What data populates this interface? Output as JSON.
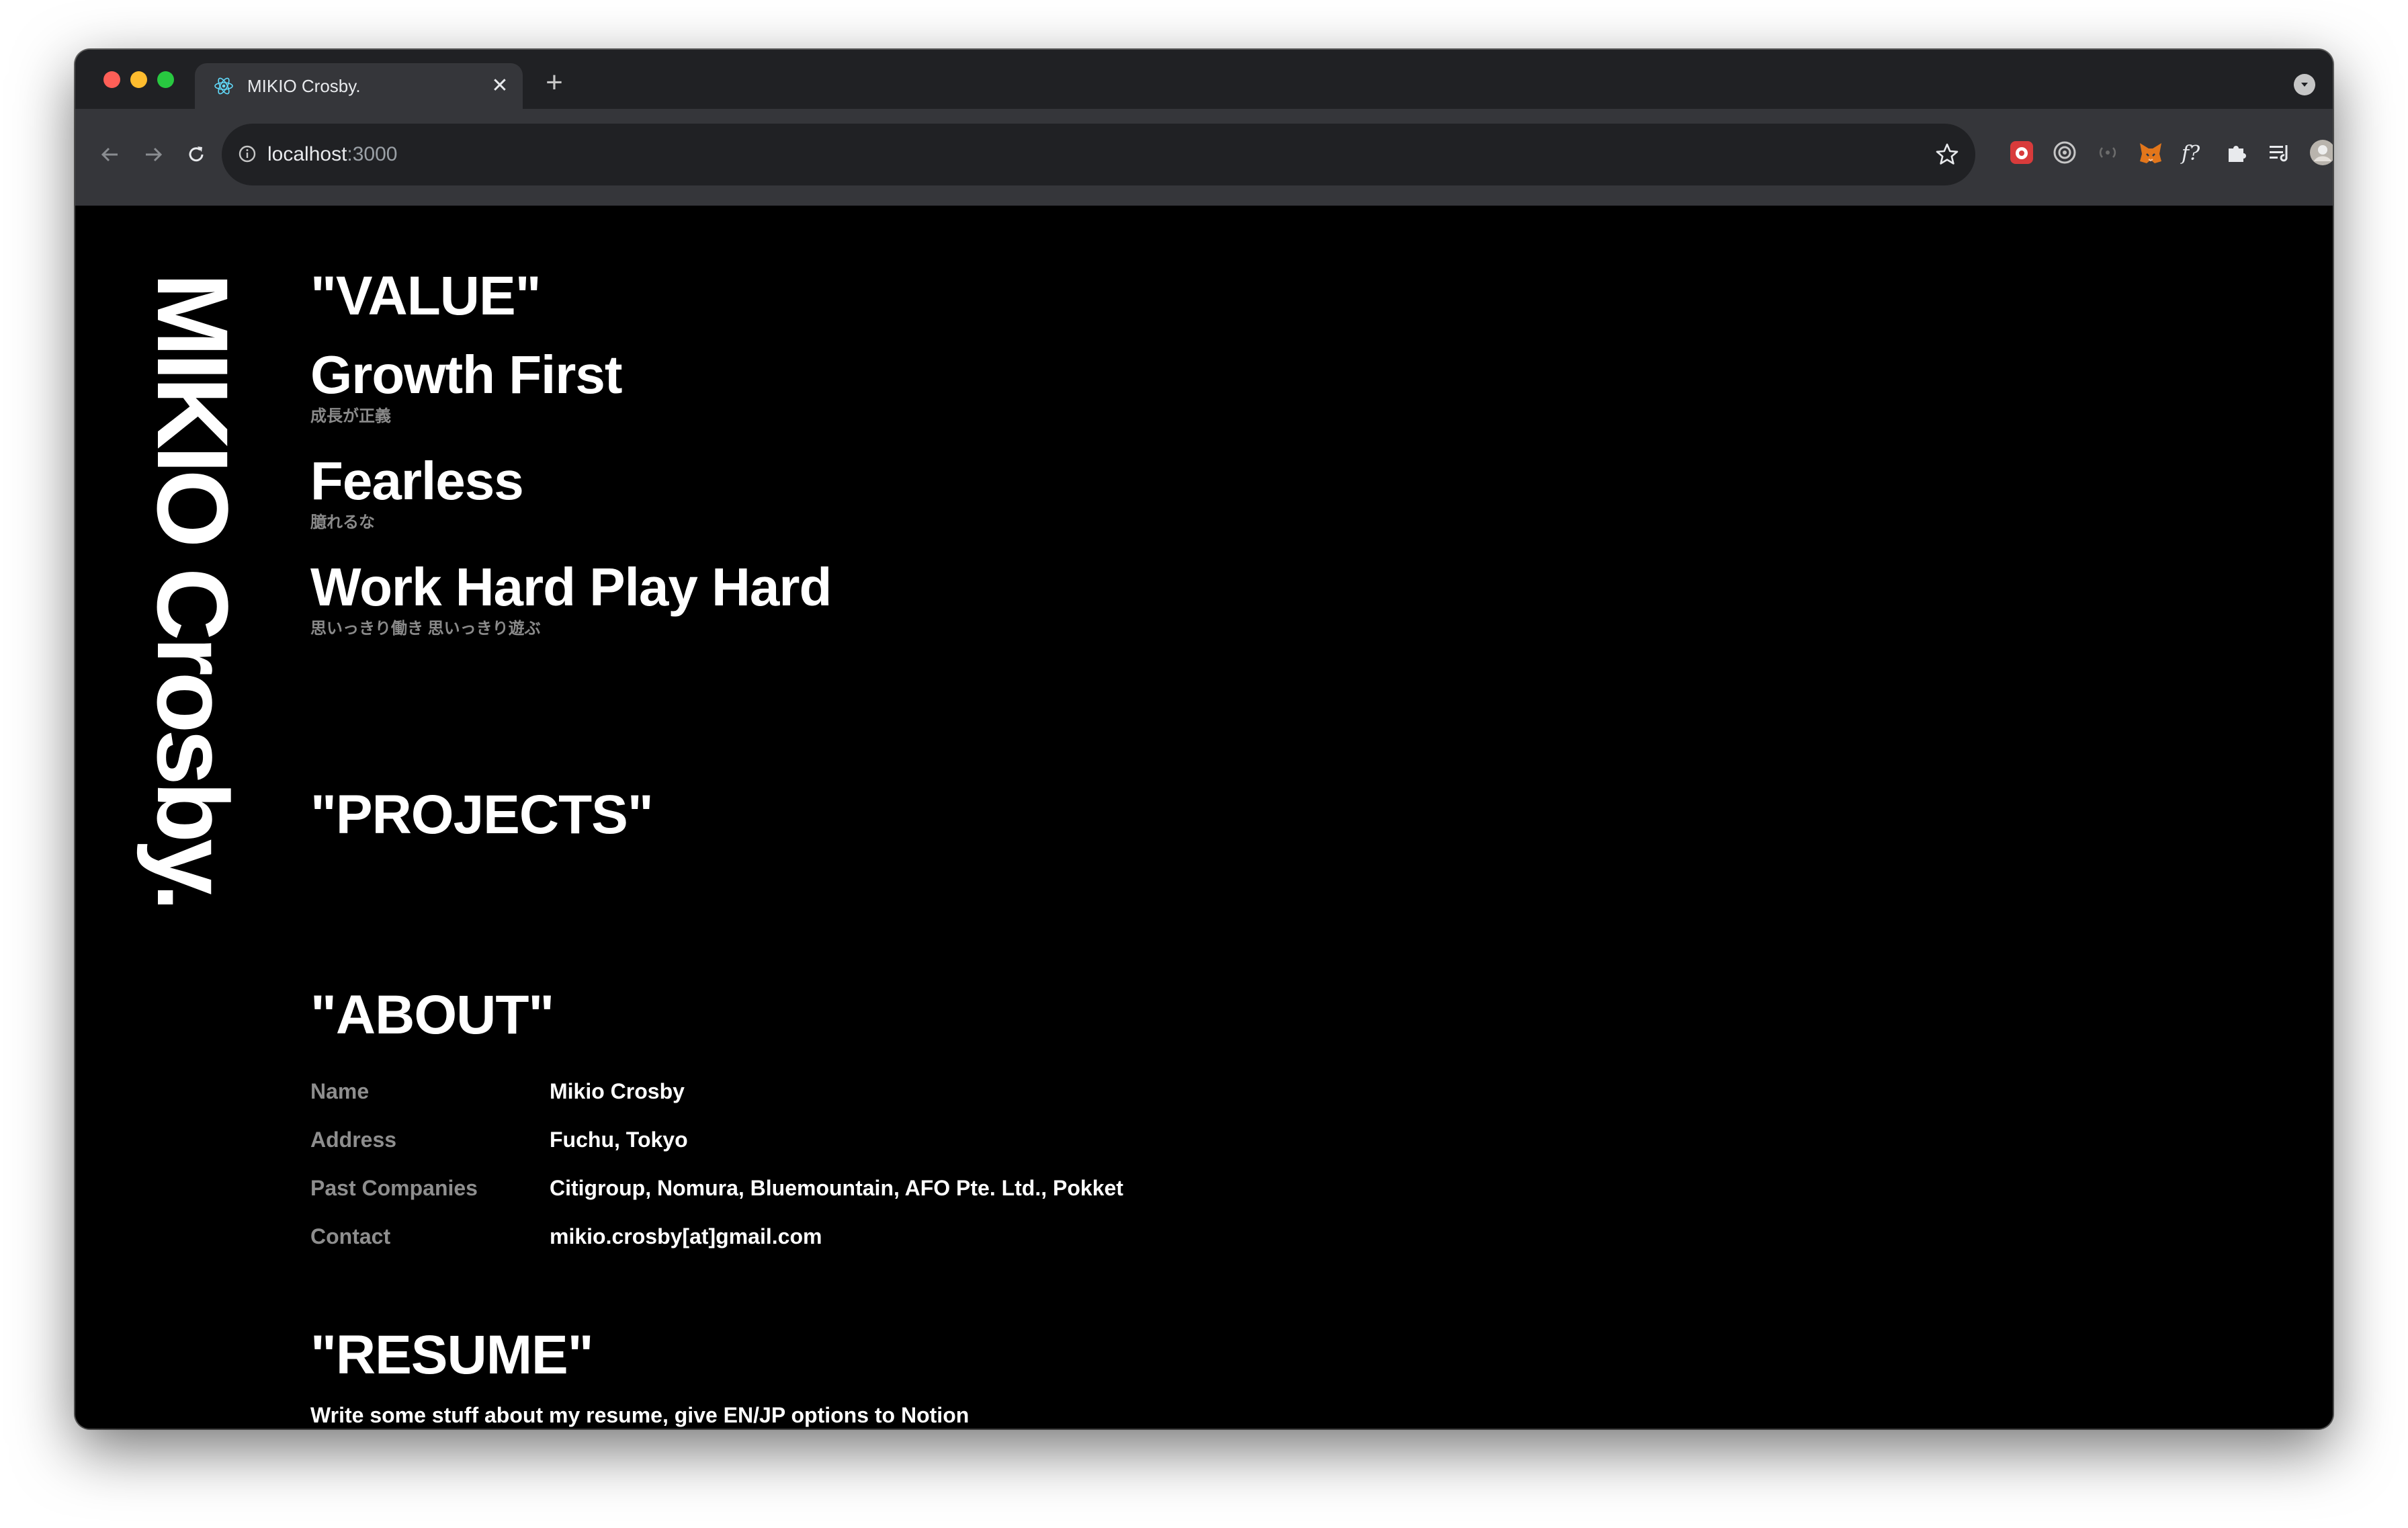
{
  "browser": {
    "tab_title": "MIKIO Crosby.",
    "tab_close": "✕",
    "new_tab": "+",
    "url_host": "localhost",
    "url_port": ":3000"
  },
  "site": {
    "brand": "MIKIO Crosby."
  },
  "value": {
    "heading": "\"VALUE\"",
    "items": [
      {
        "title": "Growth First",
        "subtitle": "成長が正義"
      },
      {
        "title": "Fearless",
        "subtitle": "臆れるな"
      },
      {
        "title": "Work Hard Play Hard",
        "subtitle": "思いっきり働き 思いっきり遊ぶ"
      }
    ]
  },
  "projects": {
    "heading": "\"PROJECTS\""
  },
  "about": {
    "heading": "\"ABOUT\"",
    "rows": [
      {
        "label": "Name",
        "value": "Mikio Crosby"
      },
      {
        "label": "Address",
        "value": "Fuchu, Tokyo"
      },
      {
        "label": "Past Companies",
        "value": "Citigroup, Nomura, Bluemountain, AFO Pte. Ltd., Pokket"
      },
      {
        "label": "Contact",
        "value": "mikio.crosby[at]gmail.com"
      }
    ]
  },
  "resume": {
    "heading": "\"RESUME\"",
    "text": "Write some stuff about my resume, give EN/JP options to Notion"
  }
}
